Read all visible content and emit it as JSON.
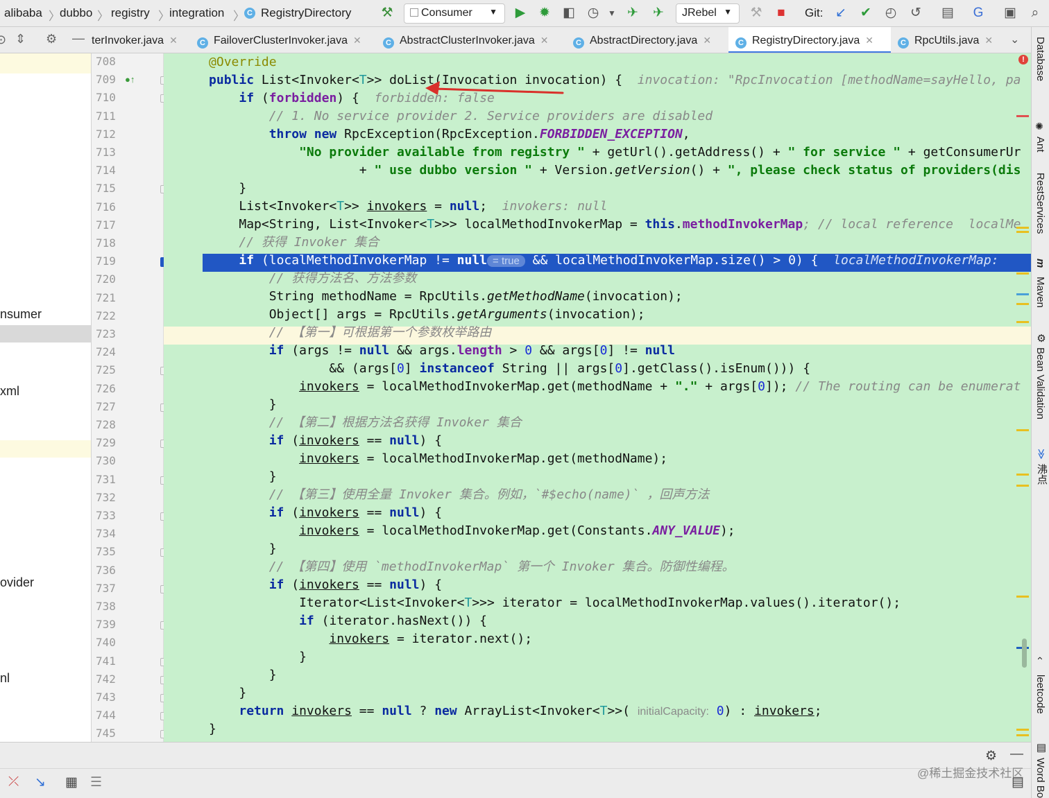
{
  "breadcrumb": [
    "alibaba",
    "dubbo",
    "registry",
    "integration",
    "RegistryDirectory"
  ],
  "toolbar": {
    "run_config": "Consumer",
    "jrebel": "JRebel",
    "git_label": "Git:"
  },
  "tabs": [
    {
      "label": "terInvoker.java"
    },
    {
      "label": "FailoverClusterInvoker.java"
    },
    {
      "label": "AbstractClusterInvoker.java"
    },
    {
      "label": "AbstractDirectory.java"
    },
    {
      "label": "RegistryDirectory.java",
      "active": true
    },
    {
      "label": "RpcUtils.java"
    }
  ],
  "sidebar_fragments": [
    "nsumer",
    "xml",
    "ovider",
    "nl"
  ],
  "line_numbers": [
    "708",
    "709",
    "710",
    "711",
    "712",
    "713",
    "714",
    "715",
    "716",
    "717",
    "718",
    "719",
    "720",
    "721",
    "722",
    "723",
    "724",
    "725",
    "726",
    "727",
    "728",
    "729",
    "730",
    "731",
    "732",
    "733",
    "734",
    "735",
    "736",
    "737",
    "738",
    "739",
    "740",
    "741",
    "742",
    "743",
    "744",
    "745"
  ],
  "code": {
    "l708": "@Override",
    "l709_a": "public",
    "l709_b": " List<Invoker<",
    "l709_c": "T",
    "l709_d": ">> doList(Invocation invocation) {  ",
    "l709_hint": "invocation: \"RpcInvocation [methodName=sayHello, pa",
    "l710_hint": "forbidden: false",
    "l711": "// 1. No service provider 2. Service providers are disabled",
    "l712_b": "RpcException(RpcException.",
    "l712_c": "FORBIDDEN_EXCEPTION",
    "l713_a": "\"No provider available from registry \"",
    "l713_b": " + getUrl().getAddress() + ",
    "l713_c": "\" for service \"",
    "l713_d": " + getConsumerUr",
    "l714_a": "\" use dubbo version \"",
    "l714_b": " + Version.",
    "l714_c": "getVersion",
    "l714_d": "() + ",
    "l714_e": "\", please check status of providers(dis",
    "l716_hint": "invokers: null",
    "l717_a": "Map<String, List<Invoker<",
    "l717_b": ">>> localMethodInvokerMap = ",
    "l717_c": "methodInvokerMap",
    "l717_d": "; // local reference  ",
    "l717_hint": "localMe",
    "l718": "// 获得 Invoker 集合",
    "l719_a": "(localMethodInvokerMap != ",
    "l719_badge": "= true",
    "l719_b": " && localMethodInvokerMap.size() > 0) {  ",
    "l719_hint": "localMethodInvokerMap:",
    "l720": "// 获得方法名、方法参数",
    "l721_a": "String methodName = RpcUtils.",
    "l721_b": "getMethodName",
    "l721_c": "(invocation);",
    "l722_a": "Object[] args = RpcUtils.",
    "l722_b": "getArguments",
    "l722_c": "(invocation);",
    "l723": "// 【第一】可根据第一个参数枚举路由",
    "l725_b": "String || args[",
    "l725_c": "].getClass().isEnum())) {",
    "l726_b": " = localMethodInvokerMap.get(methodName + ",
    "l726_c": "\".\"",
    "l726_d": " + args[",
    "l726_e": "]); ",
    "l726_f": "// The routing can be enumerat",
    "l728": "// 【第二】根据方法名获得 Invoker 集合",
    "l730_b": " = localMethodInvokerMap.get(methodName);",
    "l732": "// 【第三】使用全量 Invoker 集合。例如，`#$echo(name)` ，回声方法",
    "l734_b": " = localMethodInvokerMap.get(Constants.",
    "l734_c": "ANY_VALUE",
    "l734_d": ");",
    "l736": "// 【第四】使用 `methodInvokerMap` 第一个 Invoker 集合。防御性编程。",
    "l738_a": "Iterator<List<Invoker<",
    "l738_b": ">>> iterator = localMethodInvokerMap.values().iterator();",
    "l739": "(iterator.hasNext()) {",
    "l740_b": " = iterator.next();",
    "l744_c": " ArrayList<Invoker<",
    "l744_d": ">>( ",
    "l744_param": "initialCapacity:",
    "l744_e": " 0",
    "l744_f": ") : "
  },
  "right_tools": [
    "Database",
    "Ant",
    "RestServices",
    "Maven",
    "Bean Validation",
    "沸点",
    "leetcode",
    "Word Bo"
  ],
  "watermark": "@稀土掘金技术社区",
  "colors": {
    "editor_bg": "#c8f0cd",
    "exec_line": "#2157c4",
    "caret_line": "#fcf8de",
    "arrow": "#d9302a"
  }
}
